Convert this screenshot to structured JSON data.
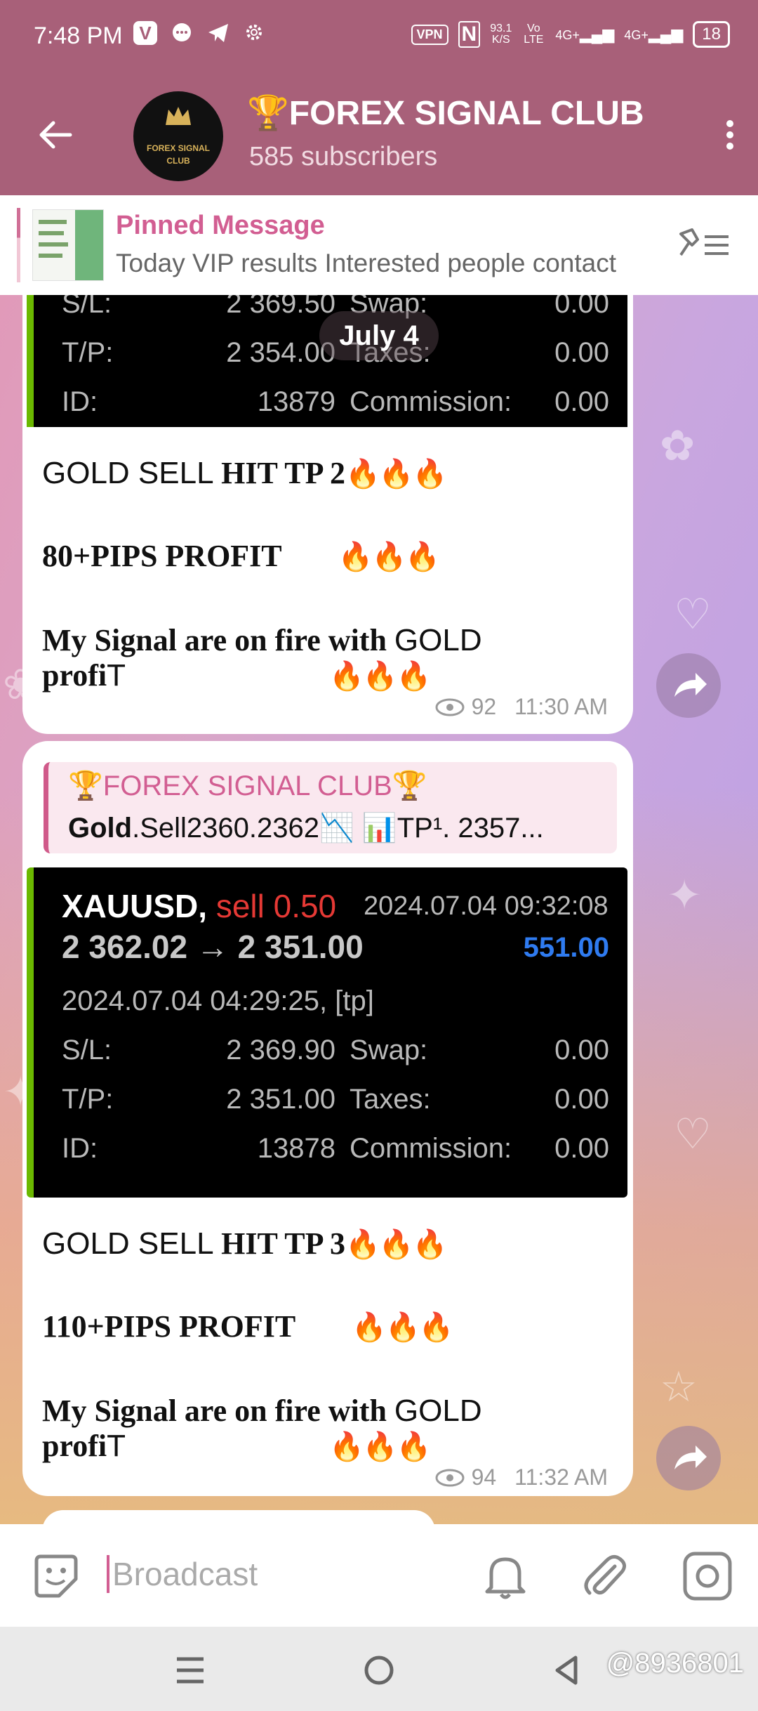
{
  "status_bar": {
    "time": "7:48 PM",
    "speed_value": "93.1",
    "speed_unit": "K/S",
    "vpn": "VPN",
    "net1": "Vo LTE",
    "net2": "4G+",
    "net3": "4G+",
    "battery": "18"
  },
  "header": {
    "title": "🏆FOREX SIGNAL CLUB",
    "subscribers": "585 subscribers",
    "logo_text_1": "FOREX SIGNAL",
    "logo_text_2": "CLUB"
  },
  "pinned": {
    "title": "Pinned Message",
    "text": "Today VIP results  Interested people contact"
  },
  "date_pill": "July 4",
  "messages": [
    {
      "screenshot_rows": [
        {
          "label": "S/L:",
          "value": "2 369.50",
          "label2": "Swap:",
          "value2": "0.00"
        },
        {
          "label": "T/P:",
          "value": "2 354.00",
          "label2": "Taxes:",
          "value2": "0.00"
        },
        {
          "label": "ID:",
          "value": "13879",
          "label2": "Commission:",
          "value2": "0.00"
        }
      ],
      "line1_a": "GOLD SELL ",
      "line1_b": "HIT TP 2",
      "line2": "80+PIPS PROFIT",
      "line3_a": "My Signal are on fire with ",
      "line3_b": "GOLD",
      "line4_a": "profi",
      "line4_b": "T",
      "fire": "🔥🔥🔥",
      "views": "92",
      "time": "11:30 AM"
    },
    {
      "quote_title": "🏆FOREX SIGNAL CLUB🏆",
      "quote_text_b": "Gold",
      "quote_text": ".Sell2360.2362📉  📊TP¹.  2357...",
      "screenshot": {
        "symbol": "XAUUSD,",
        "action": "sell 0.50",
        "close_time": "2024.07.04 09:32:08",
        "prices": "2 362.02 → 2 351.00",
        "profit": "551.00",
        "open_time": "2024.07.04 04:29:25, [tp]",
        "rows": [
          {
            "label": "S/L:",
            "value": "2 369.90",
            "label2": "Swap:",
            "value2": "0.00"
          },
          {
            "label": "T/P:",
            "value": "2 351.00",
            "label2": "Taxes:",
            "value2": "0.00"
          },
          {
            "label": "ID:",
            "value": "13878",
            "label2": "Commission:",
            "value2": "0.00"
          }
        ]
      },
      "line1_a": "GOLD SELL ",
      "line1_b": "HIT TP 3",
      "line2": "110+PIPS PROFIT",
      "line3_a": "My Signal are on fire with ",
      "line3_b": "GOLD",
      "line4_a": "profi",
      "line4_b": "T",
      "fire": "🔥🔥🔥",
      "views": "94",
      "time": "11:32 AM"
    }
  ],
  "composer": {
    "placeholder": "Broadcast"
  },
  "watermark": "@8936801",
  "colors": {
    "header": "#a86079",
    "accent": "#d25e92",
    "profit": "#2f7bf0",
    "sell": "#e53935"
  }
}
